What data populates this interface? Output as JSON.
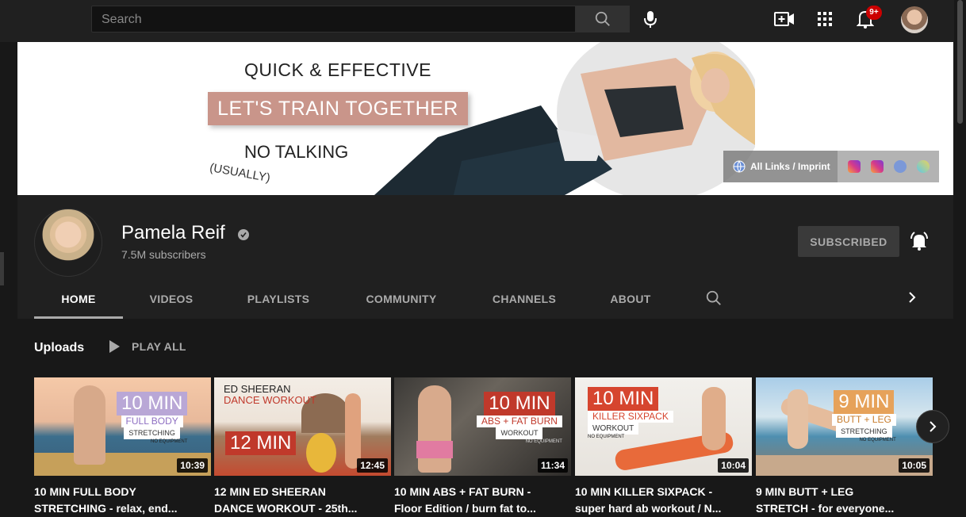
{
  "topbar": {
    "search_placeholder": "Search",
    "notification_badge": "9+"
  },
  "banner": {
    "line1": "QUICK & EFFECTIVE",
    "line2": "LET'S TRAIN TOGETHER",
    "line3": "NO TALKING",
    "line4": "(USUALLY)",
    "links_label": "All Links / Imprint"
  },
  "channel": {
    "name": "Pamela Reif",
    "subscribers": "7.5M subscribers",
    "subscribe_label": "SUBSCRIBED"
  },
  "tabs": [
    "HOME",
    "VIDEOS",
    "PLAYLISTS",
    "COMMUNITY",
    "CHANNELS",
    "ABOUT"
  ],
  "uploads": {
    "title": "Uploads",
    "play_all": "PLAY ALL",
    "videos": [
      {
        "duration": "10:39",
        "title": "10 MIN FULL BODY",
        "title2": "STRETCHING - relax, end...",
        "thumb_big": "10 MIN",
        "thumb_small": "FULL BODY",
        "thumb_small2": "STRETCHING",
        "thumb_tiny": "NO EQUIPMENT"
      },
      {
        "duration": "12:45",
        "title": "12 MIN ED SHEERAN",
        "title2": "DANCE WORKOUT - 25th...",
        "thumb_big": "12 MIN",
        "thumb_small": "ED SHEERAN",
        "thumb_small2": "DANCE WORKOUT"
      },
      {
        "duration": "11:34",
        "title": "10 MIN ABS + FAT BURN -",
        "title2": "Floor Edition / burn fat to...",
        "thumb_big": "10 MIN",
        "thumb_small": "ABS + FAT BURN",
        "thumb_small2": "WORKOUT",
        "thumb_tiny": "NO EQUIPMENT"
      },
      {
        "duration": "10:04",
        "title": "10 MIN KILLER SIXPACK -",
        "title2": "super hard ab workout / N...",
        "thumb_big": "10 MIN",
        "thumb_small": "KILLER SIXPACK",
        "thumb_small2": "WORKOUT",
        "thumb_tiny": "NO EQUIPMENT"
      },
      {
        "duration": "10:05",
        "title": "9 MIN BUTT + LEG",
        "title2": "STRETCH - for everyone...",
        "thumb_big": "9 MIN",
        "thumb_small": "BUTT + LEG",
        "thumb_small2": "STRETCHING",
        "thumb_tiny": "NO EQUIPMENT"
      }
    ]
  },
  "colors": {
    "background": "#181818",
    "topbar": "#202020",
    "accent_pink": "#c9958a",
    "badge_red": "#cc0000"
  }
}
